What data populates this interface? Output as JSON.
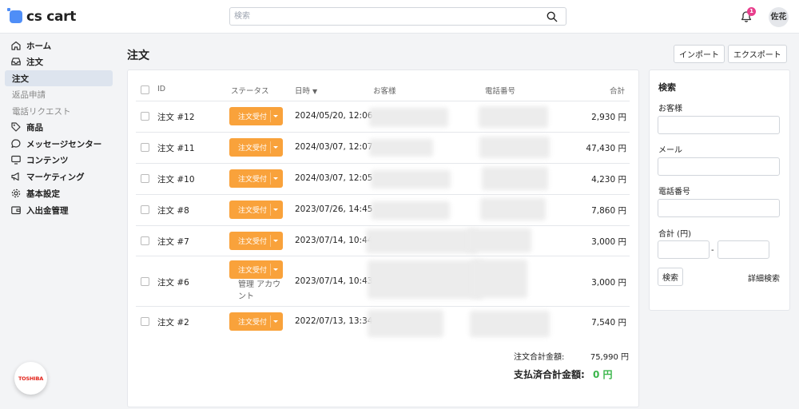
{
  "header": {
    "logo_text": "cs cart",
    "search_placeholder": "検索",
    "notification_count": "1",
    "user_name": "佐花"
  },
  "sidebar": {
    "items": [
      {
        "label": "ホーム",
        "icon": "home-icon"
      },
      {
        "label": "注文",
        "icon": "inbox-icon"
      },
      {
        "label": "注文",
        "sub": true,
        "active": true
      },
      {
        "label": "返品申請",
        "sub": true
      },
      {
        "label": "電話リクエスト",
        "sub": true
      },
      {
        "label": "商品",
        "icon": "tag-icon"
      },
      {
        "label": "メッセージセンター",
        "icon": "chat-icon"
      },
      {
        "label": "コンテンツ",
        "icon": "monitor-icon"
      },
      {
        "label": "マーケティング",
        "icon": "megaphone-icon"
      },
      {
        "label": "基本設定",
        "icon": "gear-icon"
      },
      {
        "label": "入出金管理",
        "icon": "wallet-icon"
      }
    ],
    "badge_text": "TOSHIBA"
  },
  "page": {
    "title": "注文",
    "import_label": "インポート",
    "export_label": "エクスポート"
  },
  "table": {
    "columns": {
      "id": "ID",
      "status": "ステータス",
      "date": "日時",
      "customer": "お客様",
      "phone": "電話番号",
      "total": "合計"
    },
    "rows": [
      {
        "id": "注文 #12",
        "status": "注文受付",
        "date": "2024/05/20, 12:06",
        "total": "2,930 円"
      },
      {
        "id": "注文 #11",
        "status": "注文受付",
        "date": "2024/03/07, 12:07",
        "total": "47,430 円"
      },
      {
        "id": "注文 #10",
        "status": "注文受付",
        "date": "2024/03/07, 12:05",
        "total": "4,230 円"
      },
      {
        "id": "注文 #8",
        "status": "注文受付",
        "date": "2023/07/26, 14:45",
        "total": "7,860 円"
      },
      {
        "id": "注文 #7",
        "status": "注文受付",
        "date": "2023/07/14, 10:44",
        "total": "3,000 円"
      },
      {
        "id": "注文 #6",
        "status": "注文受付",
        "date": "2023/07/14, 10:43",
        "total": "3,000 円",
        "note1": "管理 アカウ",
        "note2": "ント"
      },
      {
        "id": "注文 #2",
        "status": "注文受付",
        "date": "2022/07/13, 13:34",
        "total": "7,540 円"
      }
    ]
  },
  "summary": {
    "order_total_label": "注文合計金額:",
    "order_total_value": "75,990 円",
    "paid_total_label": "支払済合計金額:",
    "paid_total_value": "0 円"
  },
  "filter": {
    "title": "検索",
    "customer_label": "お客様",
    "email_label": "メール",
    "phone_label": "電話番号",
    "total_label": "合計 (円)",
    "range_separator": "-",
    "search_button": "検索",
    "advanced_link": "詳細検索"
  },
  "colors": {
    "status_orange": "#f9a23b",
    "paid_green": "#3ab54a",
    "active_nav": "#dde4ee",
    "brand_blue": "#4f8ef7"
  }
}
